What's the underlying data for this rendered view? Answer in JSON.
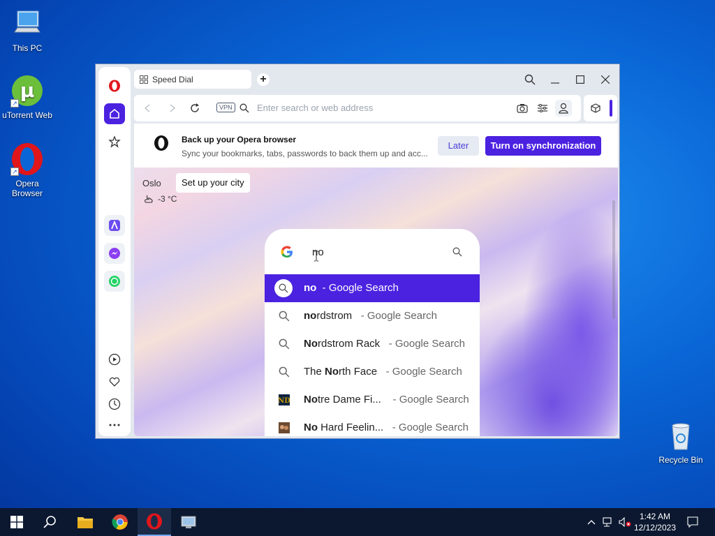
{
  "desktop": {
    "icons": [
      {
        "label": "This PC"
      },
      {
        "label": "uTorrent Web"
      },
      {
        "label": "Opera Browser"
      },
      {
        "label": "Recycle Bin"
      }
    ]
  },
  "browser": {
    "tab_title": "Speed Dial",
    "address_placeholder": "Enter search or web address",
    "vpn_label": "VPN",
    "sync_banner": {
      "title": "Back up your Opera browser",
      "subtitle": "Sync your bookmarks, tabs, passwords to back them up and acc...",
      "later_label": "Later",
      "sync_label": "Turn on synchronization"
    },
    "weather": {
      "city": "Oslo",
      "tooltip": "Set up your city",
      "temperature": "-3 °C"
    },
    "search_box": {
      "query": "no",
      "suggestions": [
        {
          "bold": "no",
          "rest": "",
          "suffix": "- Google Search",
          "icon": "search-icon",
          "selected": true
        },
        {
          "bold": "no",
          "rest": "rdstrom",
          "suffix": "- Google Search",
          "icon": "search-icon",
          "selected": false
        },
        {
          "bold": "No",
          "rest": "rdstrom Rack",
          "suffix": "- Google Search",
          "icon": "search-icon",
          "selected": false
        },
        {
          "pre": "The ",
          "bold": "No",
          "rest": "rth Face",
          "suffix": "- Google Search",
          "icon": "search-icon",
          "selected": false
        },
        {
          "bold": "No",
          "rest": "tre Dame Fi...",
          "suffix": "- Google Search",
          "icon": "notre-dame-logo-icon",
          "selected": false
        },
        {
          "bold": "No",
          "rest": " Hard Feelin...",
          "suffix": "- Google Search",
          "icon": "album-art-icon",
          "selected": false
        }
      ]
    }
  },
  "taskbar": {
    "time": "1:42 AM",
    "date": "12/12/2023"
  },
  "colors": {
    "accent": "#4b22e0",
    "opera_red": "#e0161b",
    "taskbar": "#0b1830"
  }
}
